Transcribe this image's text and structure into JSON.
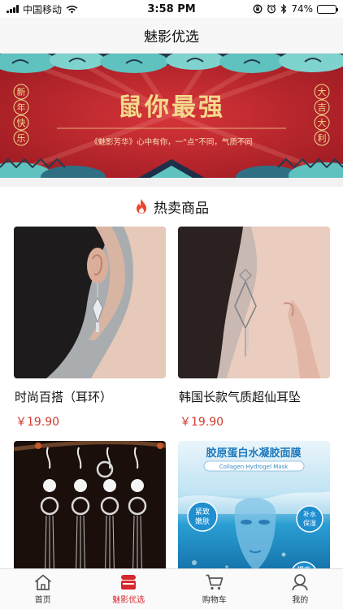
{
  "status_bar": {
    "carrier": "中国移动",
    "time": "3:58 PM",
    "battery_percent": "74%",
    "battery_level": 0.74
  },
  "nav": {
    "title": "魅影优选"
  },
  "banner": {
    "headline": "鼠你最强",
    "left_vertical": [
      "新",
      "年",
      "快",
      "乐"
    ],
    "right_vertical": [
      "大",
      "吉",
      "大",
      "利"
    ],
    "slogan": "《魅影芳华》心中有你，一“点”不同，气质不同",
    "colors": {
      "background": "#b5262a",
      "gold": "#f3d98a",
      "cloud": "#5fc2bf"
    }
  },
  "section": {
    "title": "热卖商品",
    "icon": "flame-icon"
  },
  "products": [
    {
      "title": "时尚百搭（耳环）",
      "price": "￥19.90",
      "image": "earring-model-photo"
    },
    {
      "title": "韩国长款气质超仙耳坠",
      "price": "￥19.90",
      "image": "tassel-earring-photo"
    },
    {
      "title": "",
      "price": "",
      "image": "silver-earrings-photo"
    },
    {
      "title": "",
      "price": "",
      "image": "collagen-mask-photo",
      "image_text": {
        "headline": "胶原蛋白水凝胶面膜",
        "subline": "Collagen Hydrogel Mask",
        "badge_left": [
          "紧致",
          "嫩肤"
        ],
        "badge_right": [
          "补水",
          "保湿"
        ],
        "badge_bottom": "提亮"
      }
    }
  ],
  "tabs": [
    {
      "label": "首页",
      "icon": "home-icon",
      "active": false
    },
    {
      "label": "魅影优选",
      "icon": "store-icon",
      "active": true
    },
    {
      "label": "购物车",
      "icon": "cart-icon",
      "active": false
    },
    {
      "label": "我的",
      "icon": "user-icon",
      "active": false
    }
  ],
  "colors": {
    "accent": "#d7282f",
    "price": "#d23a2e"
  }
}
